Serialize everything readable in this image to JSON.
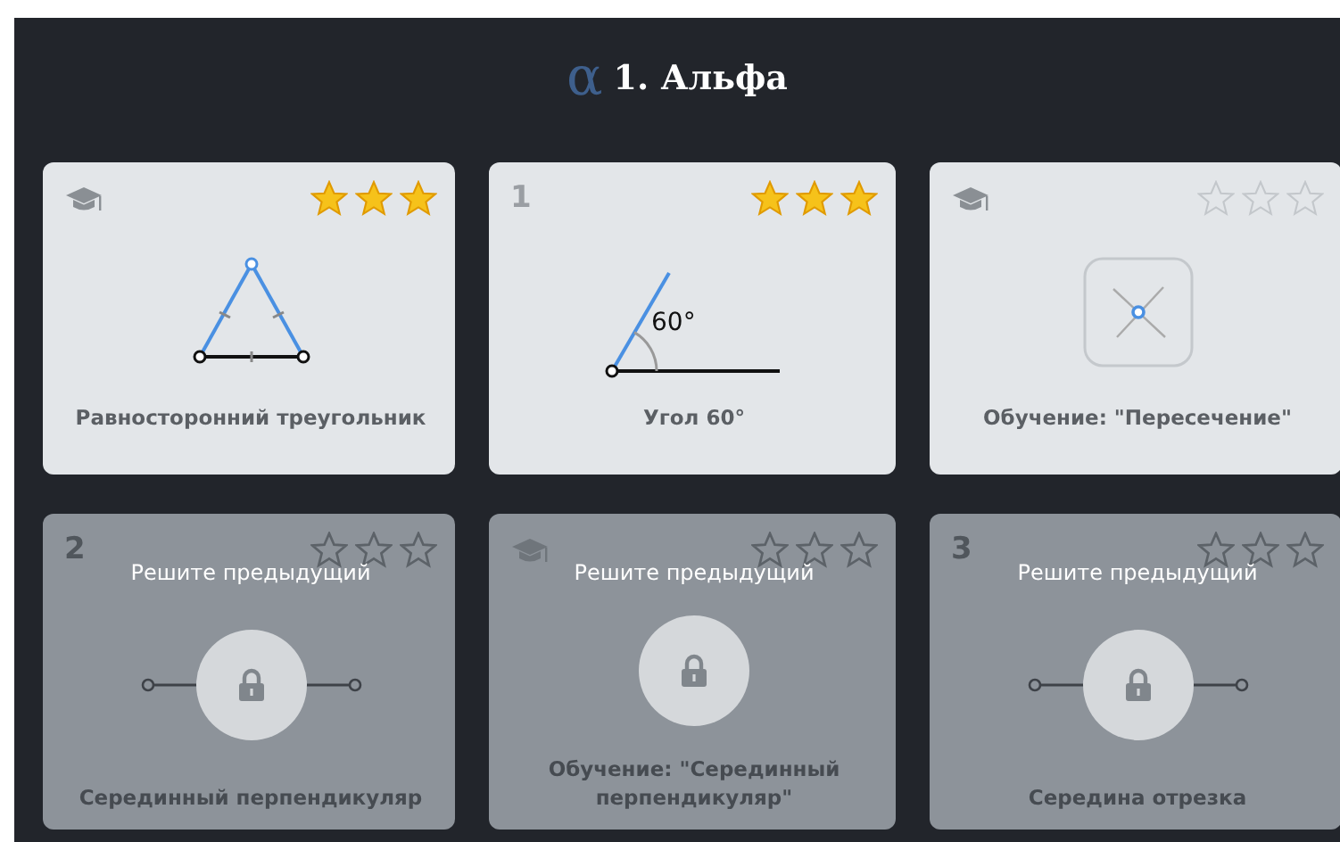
{
  "header": {
    "logo_glyph": "α",
    "title": "1. Альфа"
  },
  "cards": [
    {
      "badge": {
        "kind": "tutorial"
      },
      "stars": 3,
      "locked": false,
      "figure": {
        "kind": "triangle"
      },
      "title": "Равносторонний треугольник"
    },
    {
      "badge": {
        "kind": "number",
        "text": "1"
      },
      "stars": 3,
      "locked": false,
      "figure": {
        "kind": "angle",
        "label": "60°"
      },
      "title": "Угол 60°"
    },
    {
      "badge": {
        "kind": "tutorial"
      },
      "stars": 0,
      "locked": false,
      "figure": {
        "kind": "intersection"
      },
      "title": "Обучение: \"Пересечение\""
    },
    {
      "badge": {
        "kind": "number",
        "text": "2"
      },
      "stars": 0,
      "locked": true,
      "lock_message": "Решите предыдущий",
      "figure": {
        "kind": "segment"
      },
      "title": "Серединный перпендикуляр"
    },
    {
      "badge": {
        "kind": "tutorial"
      },
      "stars": 0,
      "locked": true,
      "lock_message": "Решите предыдущий",
      "figure": {
        "kind": "none"
      },
      "title": "Обучение: \"Серединный перпендикуляр\""
    },
    {
      "badge": {
        "kind": "number",
        "text": "3"
      },
      "stars": 0,
      "locked": true,
      "lock_message": "Решите предыдущий",
      "figure": {
        "kind": "segment"
      },
      "title": "Середина отрезка"
    }
  ]
}
